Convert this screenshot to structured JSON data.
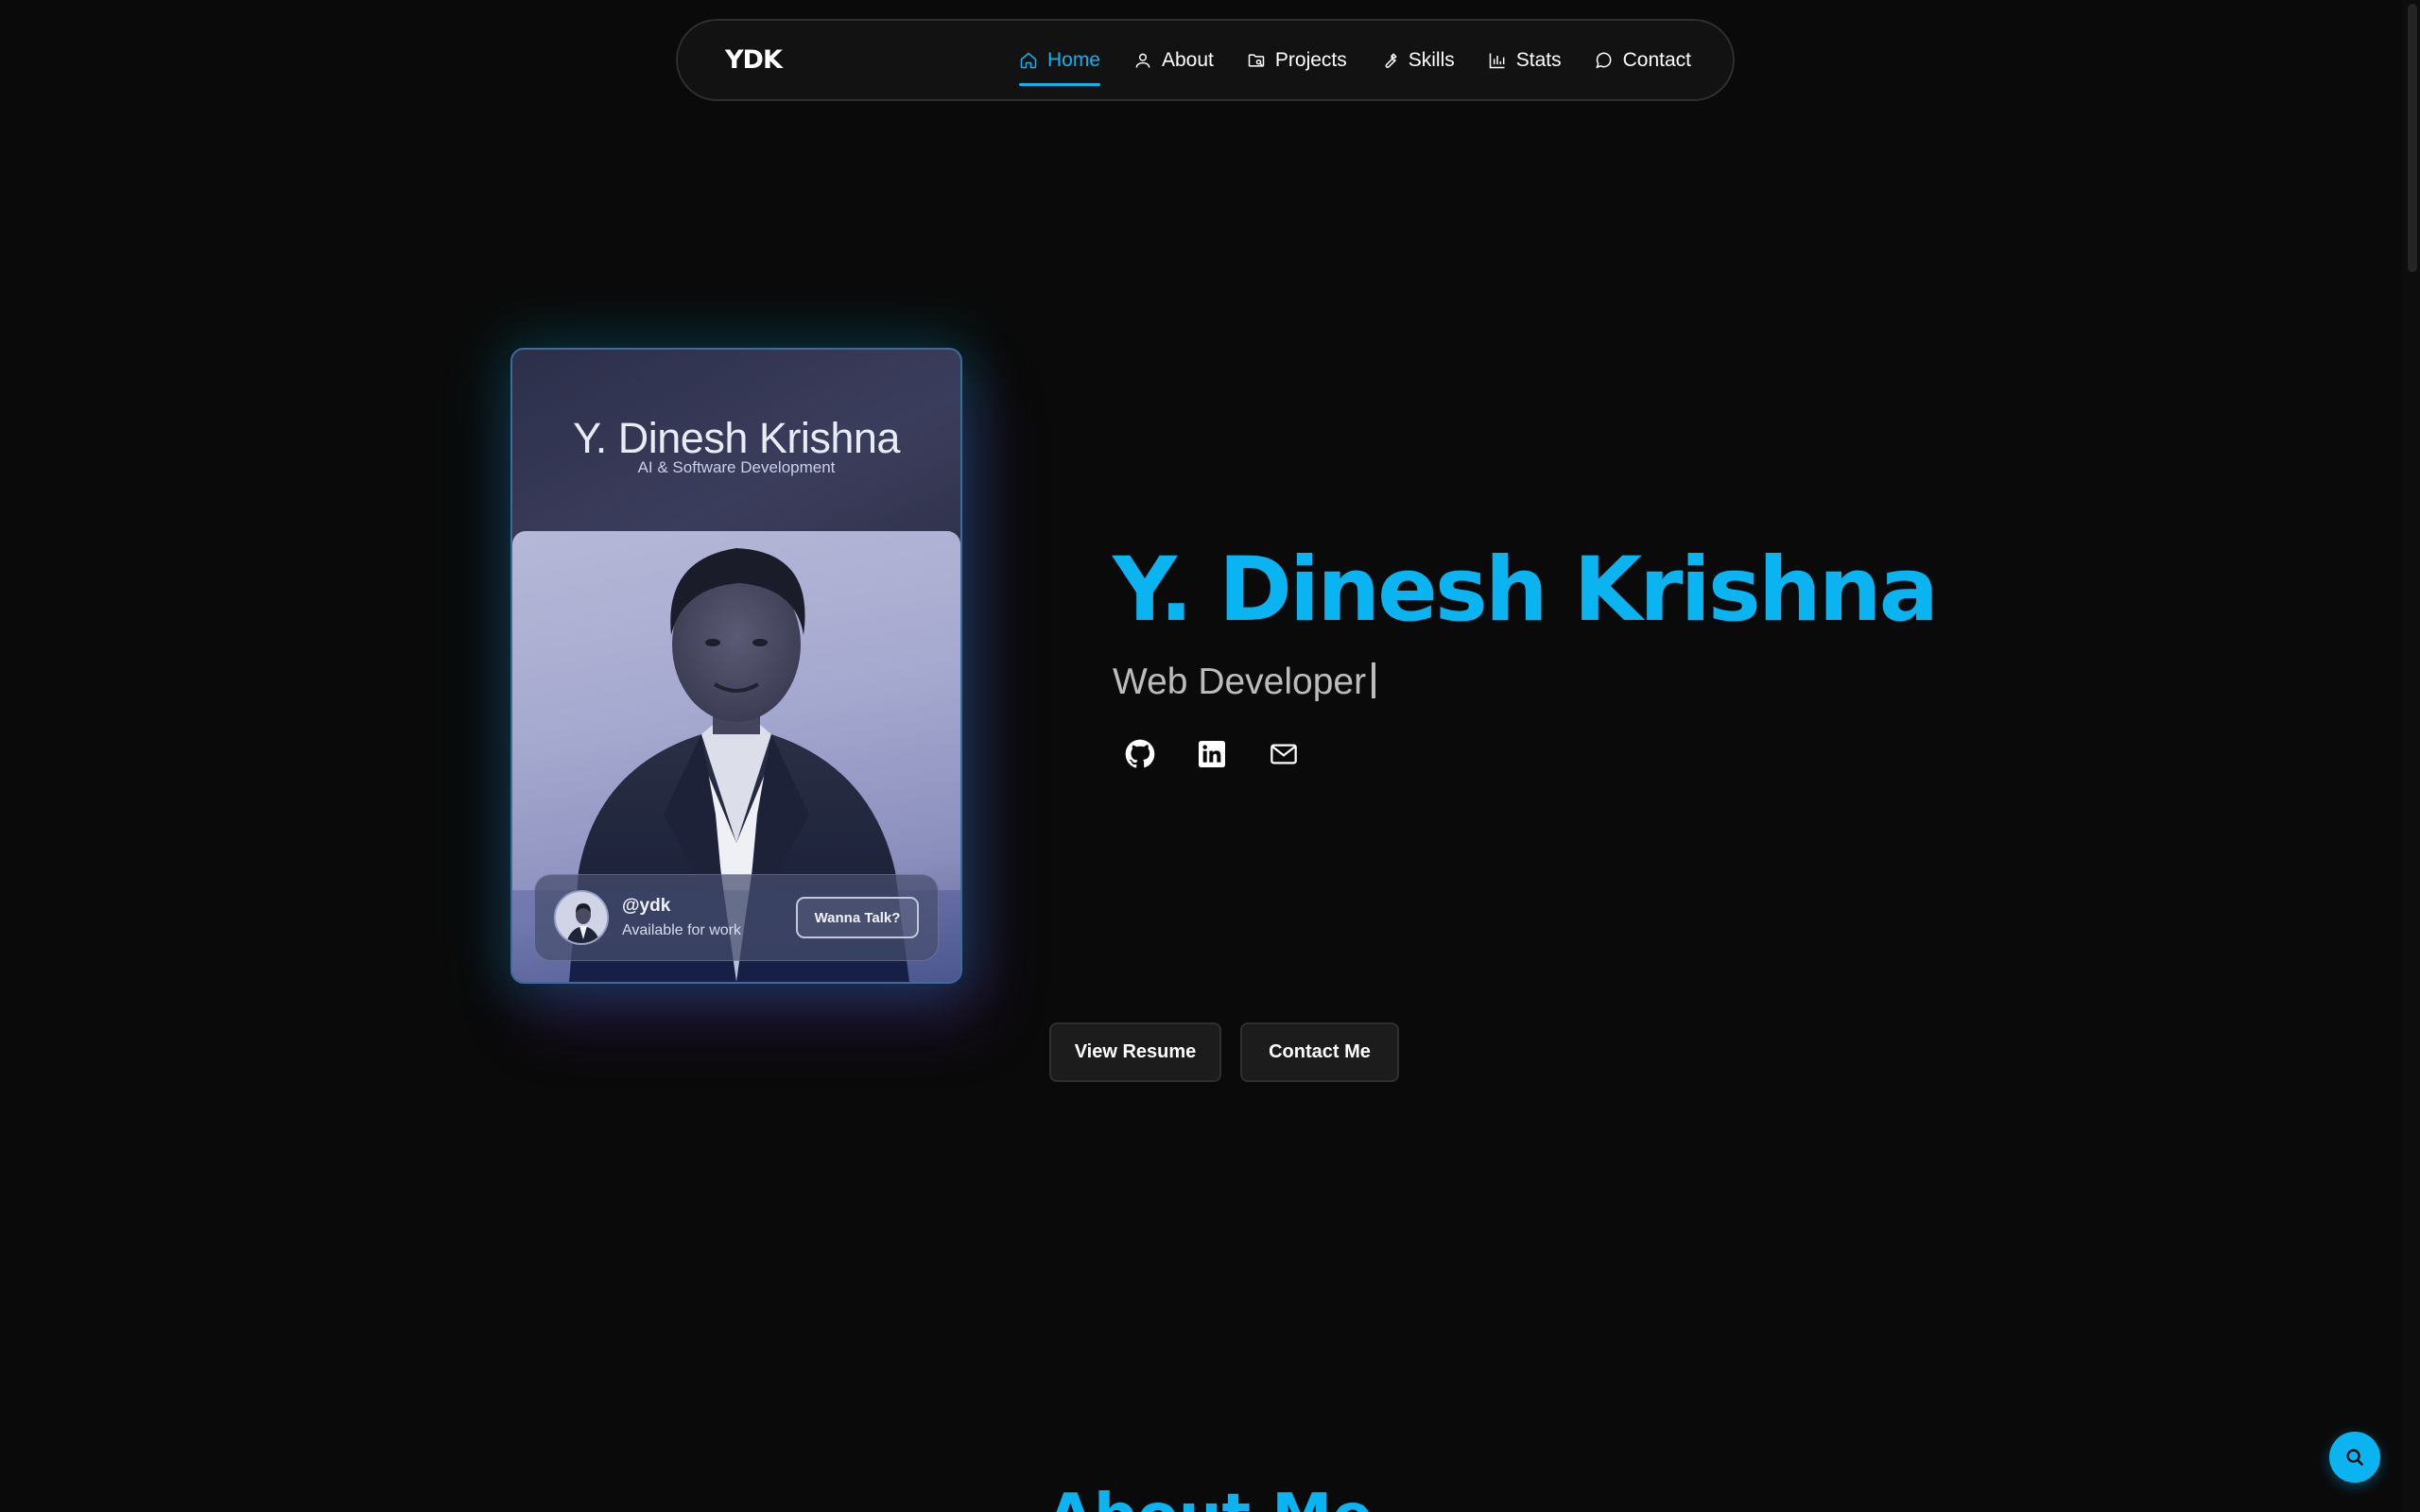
{
  "nav": {
    "logo": "YDK",
    "items": [
      {
        "label": "Home",
        "icon": "home-icon",
        "active": true
      },
      {
        "label": "About",
        "icon": "user-icon",
        "active": false
      },
      {
        "label": "Projects",
        "icon": "folder-icon",
        "active": false
      },
      {
        "label": "Skills",
        "icon": "wrench-icon",
        "active": false
      },
      {
        "label": "Stats",
        "icon": "bar-chart-icon",
        "active": false
      },
      {
        "label": "Contact",
        "icon": "message-circle-icon",
        "active": false
      }
    ]
  },
  "card": {
    "name": "Y. Dinesh Krishna",
    "role": "AI & Software Development",
    "handle": "@ydk",
    "status": "Available for work",
    "cta": "Wanna Talk?"
  },
  "hero": {
    "title": "Y. Dinesh Krishna",
    "subtitle": "Web Developer",
    "socials": [
      {
        "icon": "github-icon"
      },
      {
        "icon": "linkedin-icon"
      },
      {
        "icon": "mail-icon"
      }
    ]
  },
  "actions": {
    "resume_label": "View Resume",
    "contact_label": "Contact Me"
  },
  "next_section": {
    "heading": "About Me"
  },
  "colors": {
    "accent": "#0ab4f0",
    "background": "#0a0a0a",
    "button_bg": "#1c1c1c"
  }
}
